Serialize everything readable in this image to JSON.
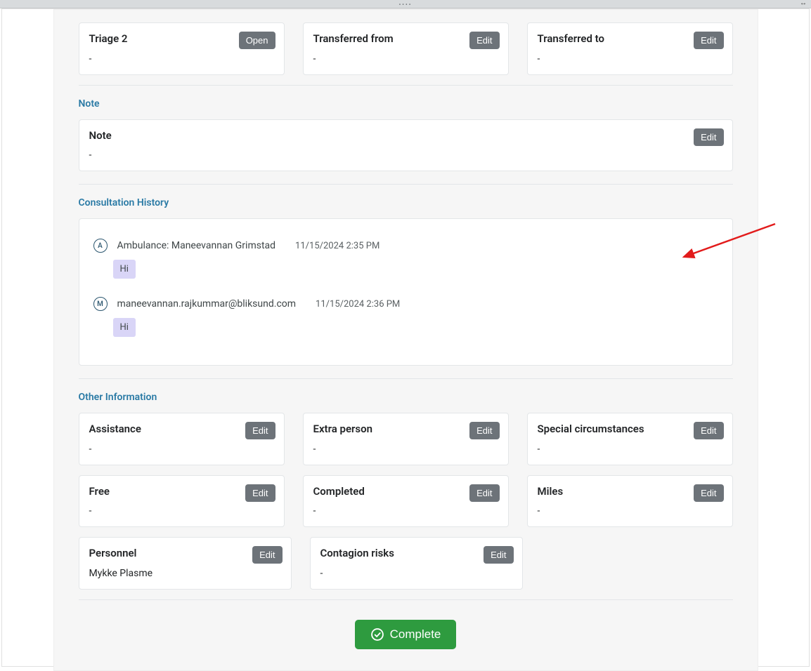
{
  "top_cards": {
    "triage2": {
      "title": "Triage 2",
      "value": "-",
      "button": "Open"
    },
    "transferred_from": {
      "title": "Transferred from",
      "value": "-",
      "button": "Edit"
    },
    "transferred_to": {
      "title": "Transferred to",
      "value": "-",
      "button": "Edit"
    }
  },
  "note_section": {
    "heading": "Note",
    "card": {
      "title": "Note",
      "value": "-",
      "button": "Edit"
    }
  },
  "history_section": {
    "heading": "Consultation History",
    "entries": [
      {
        "avatar": "A",
        "author": "Ambulance: Maneevannan Grimstad",
        "timestamp": "11/15/2024 2:35 PM",
        "message": "Hi"
      },
      {
        "avatar": "M",
        "author": "maneevannan.rajkummar@bliksund.com",
        "timestamp": "11/15/2024 2:36 PM",
        "message": "Hi"
      }
    ]
  },
  "other_section": {
    "heading": "Other Information",
    "assistance": {
      "title": "Assistance",
      "value": "-",
      "button": "Edit"
    },
    "extra_person": {
      "title": "Extra person",
      "value": "-",
      "button": "Edit"
    },
    "special": {
      "title": "Special circumstances",
      "value": "-",
      "button": "Edit"
    },
    "free": {
      "title": "Free",
      "value": "-",
      "button": "Edit"
    },
    "completed": {
      "title": "Completed",
      "value": "-",
      "button": "Edit"
    },
    "miles": {
      "title": "Miles",
      "value": "-",
      "button": "Edit"
    },
    "personnel": {
      "title": "Personnel",
      "value": "Mykke Plasme",
      "button": "Edit"
    },
    "contagion": {
      "title": "Contagion risks",
      "value": "-",
      "button": "Edit"
    }
  },
  "complete_button": "Complete"
}
